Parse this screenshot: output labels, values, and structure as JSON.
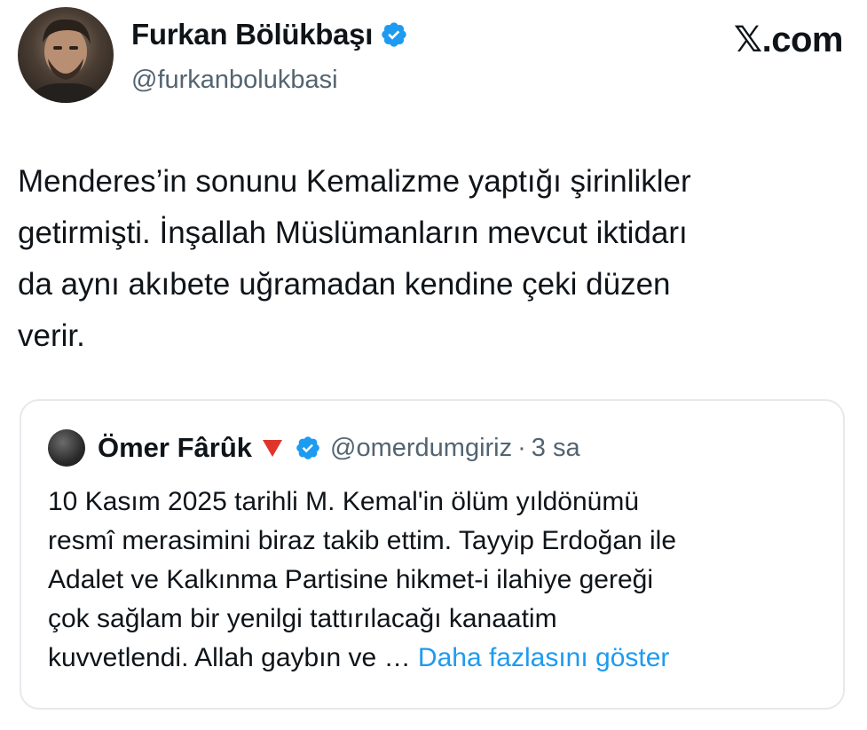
{
  "brand": "𝕏.com",
  "author": {
    "display_name": "Furkan Bölükbaşı",
    "handle": "@furkanbolukbasi"
  },
  "tweet": {
    "text": "Menderes’in sonunu Kemalizme yaptığı şirinlikler\ngetirmişti. İnşallah Müslümanların mevcut iktidarı\nda aynı akıbete uğramadan kendine çeki düzen\nverir."
  },
  "quoted_tweet": {
    "display_name": "Ömer Fârûk",
    "handle": "@omerdumgiriz",
    "separator": "·",
    "time": "3 sa",
    "text": "10 Kasım 2025 tarihli M. Kemal'in ölüm yıldönümü\nresmî merasimini biraz takib ettim. Tayyip Erdoğan ile\nAdalet ve Kalkınma Partisine hikmet-i ilahiye gereği\nçok sağlam bir yenilgi tattırılacağı kanaatim\nkuvvetlendi. Allah gaybın ve … ",
    "show_more": "Daha fazlasını göster"
  },
  "colors": {
    "verified_blue": "#1d9bf0",
    "link_blue": "#1d9bf0",
    "secondary_text": "#536471",
    "flag_red": "#e0352b"
  },
  "icons": {
    "verified": "verified-badge-icon",
    "flag": "red-triangle-icon"
  }
}
